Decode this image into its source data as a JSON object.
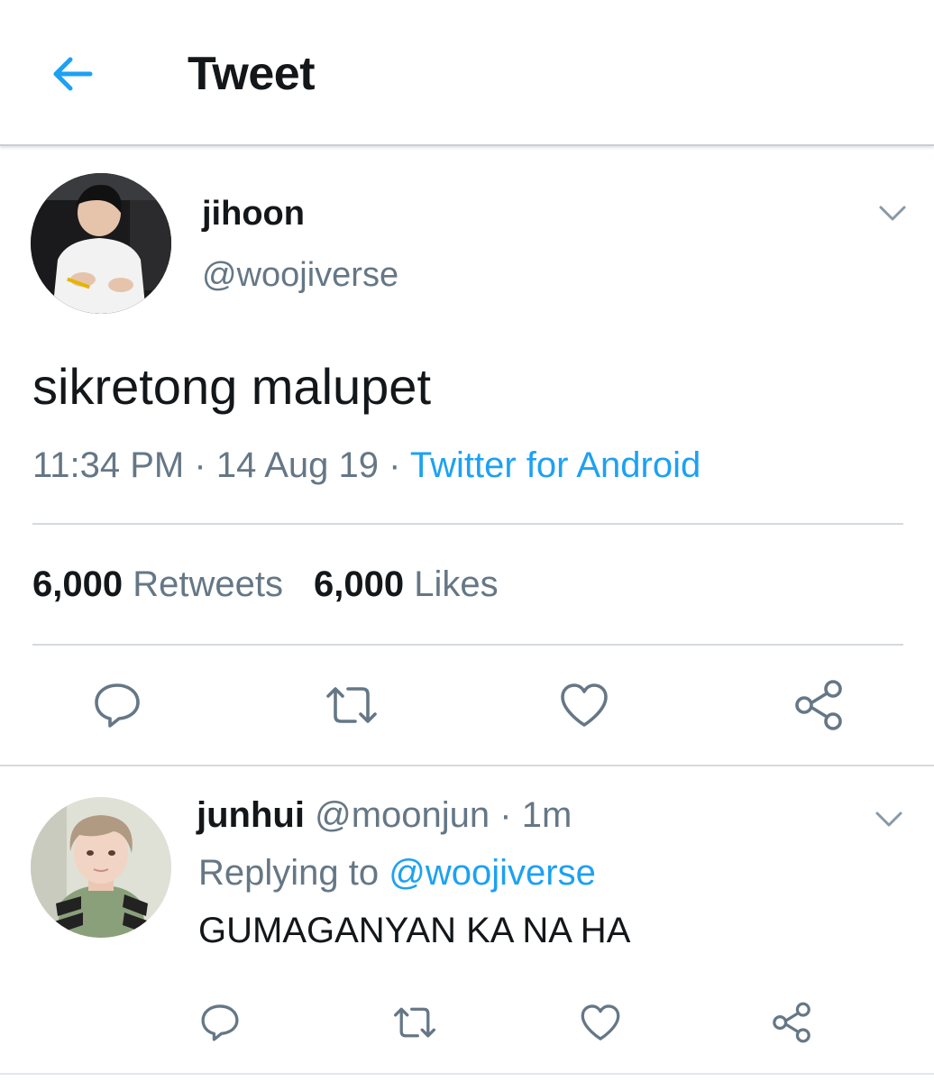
{
  "header": {
    "back_icon": "arrow-left-icon",
    "title": "Tweet",
    "accent_color": "#1da1f2"
  },
  "main_tweet": {
    "display_name": "jihoon",
    "handle": "@woojiverse",
    "text": "sikretong malupet",
    "time": "11:34 PM",
    "date": "14 Aug 19",
    "separator": "·",
    "source": "Twitter for Android",
    "retweets_count": "6,000",
    "retweets_label": "Retweets",
    "likes_count": "6,000",
    "likes_label": "Likes",
    "actions": [
      "reply-icon",
      "retweet-icon",
      "like-icon",
      "share-icon"
    ]
  },
  "reply": {
    "display_name": "junhui",
    "handle": "@moonjun",
    "separator": "·",
    "time": "1m",
    "replying_label": "Replying to",
    "replying_to": "@woojiverse",
    "text": "GUMAGANYAN KA NA HA",
    "actions": [
      "reply-icon",
      "retweet-icon",
      "like-icon",
      "share-icon"
    ]
  },
  "colors": {
    "text_primary": "#14171a",
    "text_secondary": "#657786",
    "link": "#1da1f2",
    "divider": "#d5dadf"
  }
}
